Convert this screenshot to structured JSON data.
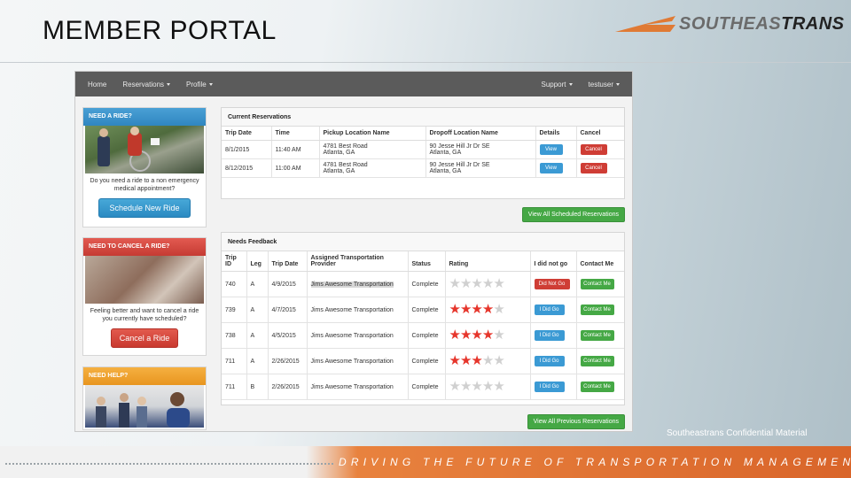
{
  "slide": {
    "title": "MEMBER PORTAL",
    "logo_main": "SOUTHEAS",
    "logo_accent": "TRANS",
    "confidential": "Southeastrans Confidential Material",
    "footer_tagline": "DRIVING THE FUTURE OF TRANSPORTATION MANAGEMENT",
    "colors": {
      "accent_orange": "#e8823e",
      "nav_gray": "#5b5b5b",
      "blue": "#3b9ad4",
      "red": "#cf3d35",
      "green": "#45a845"
    }
  },
  "navbar": {
    "home": "Home",
    "reservations": "Reservations",
    "profile": "Profile",
    "support": "Support",
    "user": "testuser"
  },
  "sidebar": {
    "need_ride": {
      "header": "NEED A RIDE?",
      "text": "Do you need a ride to a non emergency medical appointment?",
      "button": "Schedule New Ride"
    },
    "cancel_ride": {
      "header": "NEED TO CANCEL A RIDE?",
      "text": "Feeling better and want to cancel a ride you currently have scheduled?",
      "button": "Cancel a Ride"
    },
    "need_help": {
      "header": "NEED HELP?"
    }
  },
  "current_reservations": {
    "title": "Current Reservations",
    "columns": [
      "Trip Date",
      "Time",
      "Pickup Location Name",
      "Dropoff Location Name",
      "Details",
      "Cancel"
    ],
    "rows": [
      {
        "date": "8/1/2015",
        "time": "11:40 AM",
        "pickup1": "4781 Best Road",
        "pickup2": "Atlanta, GA",
        "dropoff1": "90 Jesse Hill Jr Dr SE",
        "dropoff2": "Atlanta, GA",
        "details": "View",
        "cancel": "Cancel"
      },
      {
        "date": "8/12/2015",
        "time": "11:00 AM",
        "pickup1": "4781 Best Road",
        "pickup2": "Atlanta, GA",
        "dropoff1": "90 Jesse Hill Jr Dr SE",
        "dropoff2": "Atlanta, GA",
        "details": "View",
        "cancel": "Cancel"
      }
    ],
    "view_all": "View All Scheduled Reservations"
  },
  "needs_feedback": {
    "title": "Needs Feedback",
    "columns": [
      "Trip ID",
      "Leg",
      "Trip Date",
      "Assigned Transportation Provider",
      "Status",
      "Rating",
      "I did not go",
      "Contact Me"
    ],
    "rows": [
      {
        "id": "740",
        "leg": "A",
        "date": "4/9/2015",
        "provider": "Jims Awesome Transportation",
        "status": "Complete",
        "rating": 0,
        "action": "Did Not Go",
        "contact": "Contact Me",
        "highlight": true
      },
      {
        "id": "739",
        "leg": "A",
        "date": "4/7/2015",
        "provider": "Jims Awesome Transportation",
        "status": "Complete",
        "rating": 4,
        "action": "I Did Go",
        "contact": "Contact Me",
        "highlight": false
      },
      {
        "id": "738",
        "leg": "A",
        "date": "4/5/2015",
        "provider": "Jims Awesome Transportation",
        "status": "Complete",
        "rating": 4,
        "action": "I Did Go",
        "contact": "Contact Me",
        "highlight": false
      },
      {
        "id": "711",
        "leg": "A",
        "date": "2/26/2015",
        "provider": "Jims Awesome Transportation",
        "status": "Complete",
        "rating": 3,
        "action": "I Did Go",
        "contact": "Contact Me",
        "highlight": false
      },
      {
        "id": "711",
        "leg": "B",
        "date": "2/26/2015",
        "provider": "Jims Awesome Transportation",
        "status": "Complete",
        "rating": 0,
        "action": "I Did Go",
        "contact": "Contact Me",
        "highlight": false
      }
    ],
    "view_all": "View All Previous Reservations"
  }
}
